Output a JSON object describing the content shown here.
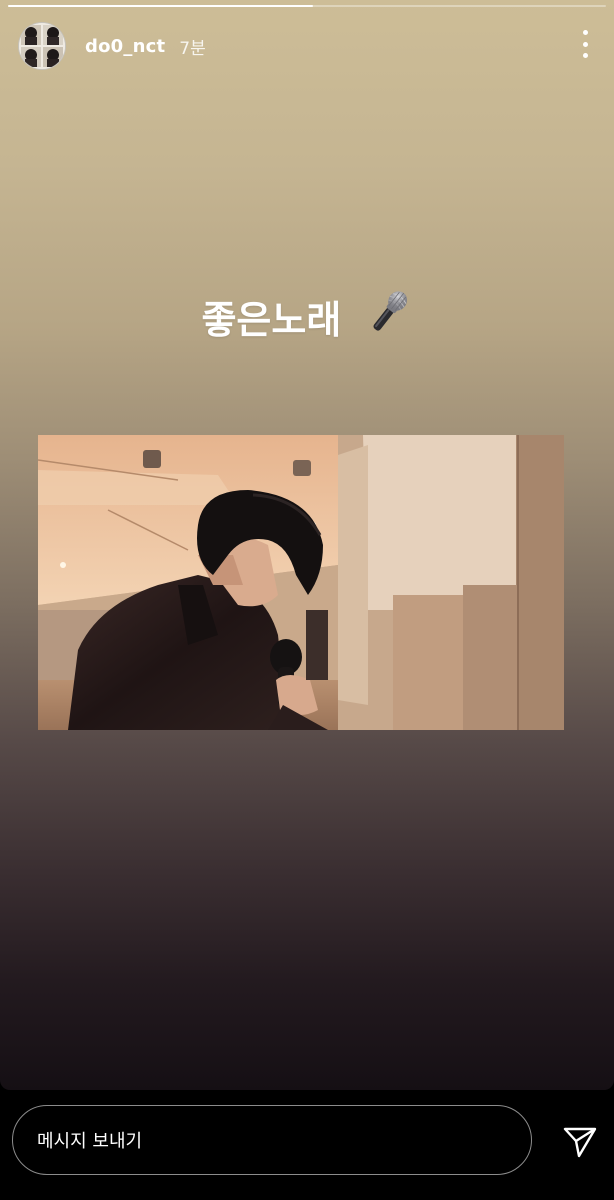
{
  "story": {
    "progress": 0.51,
    "username": "do0_nct",
    "time": "7분",
    "caption": "좋은노래",
    "caption_icon": "microphone-icon",
    "media_description": "video-still"
  },
  "reply": {
    "placeholder": "메시지 보내기",
    "send_icon": "send-icon"
  },
  "colors": {
    "gradient_top": "#cdbd97",
    "gradient_bottom": "#150f14",
    "text": "#ffffff"
  }
}
